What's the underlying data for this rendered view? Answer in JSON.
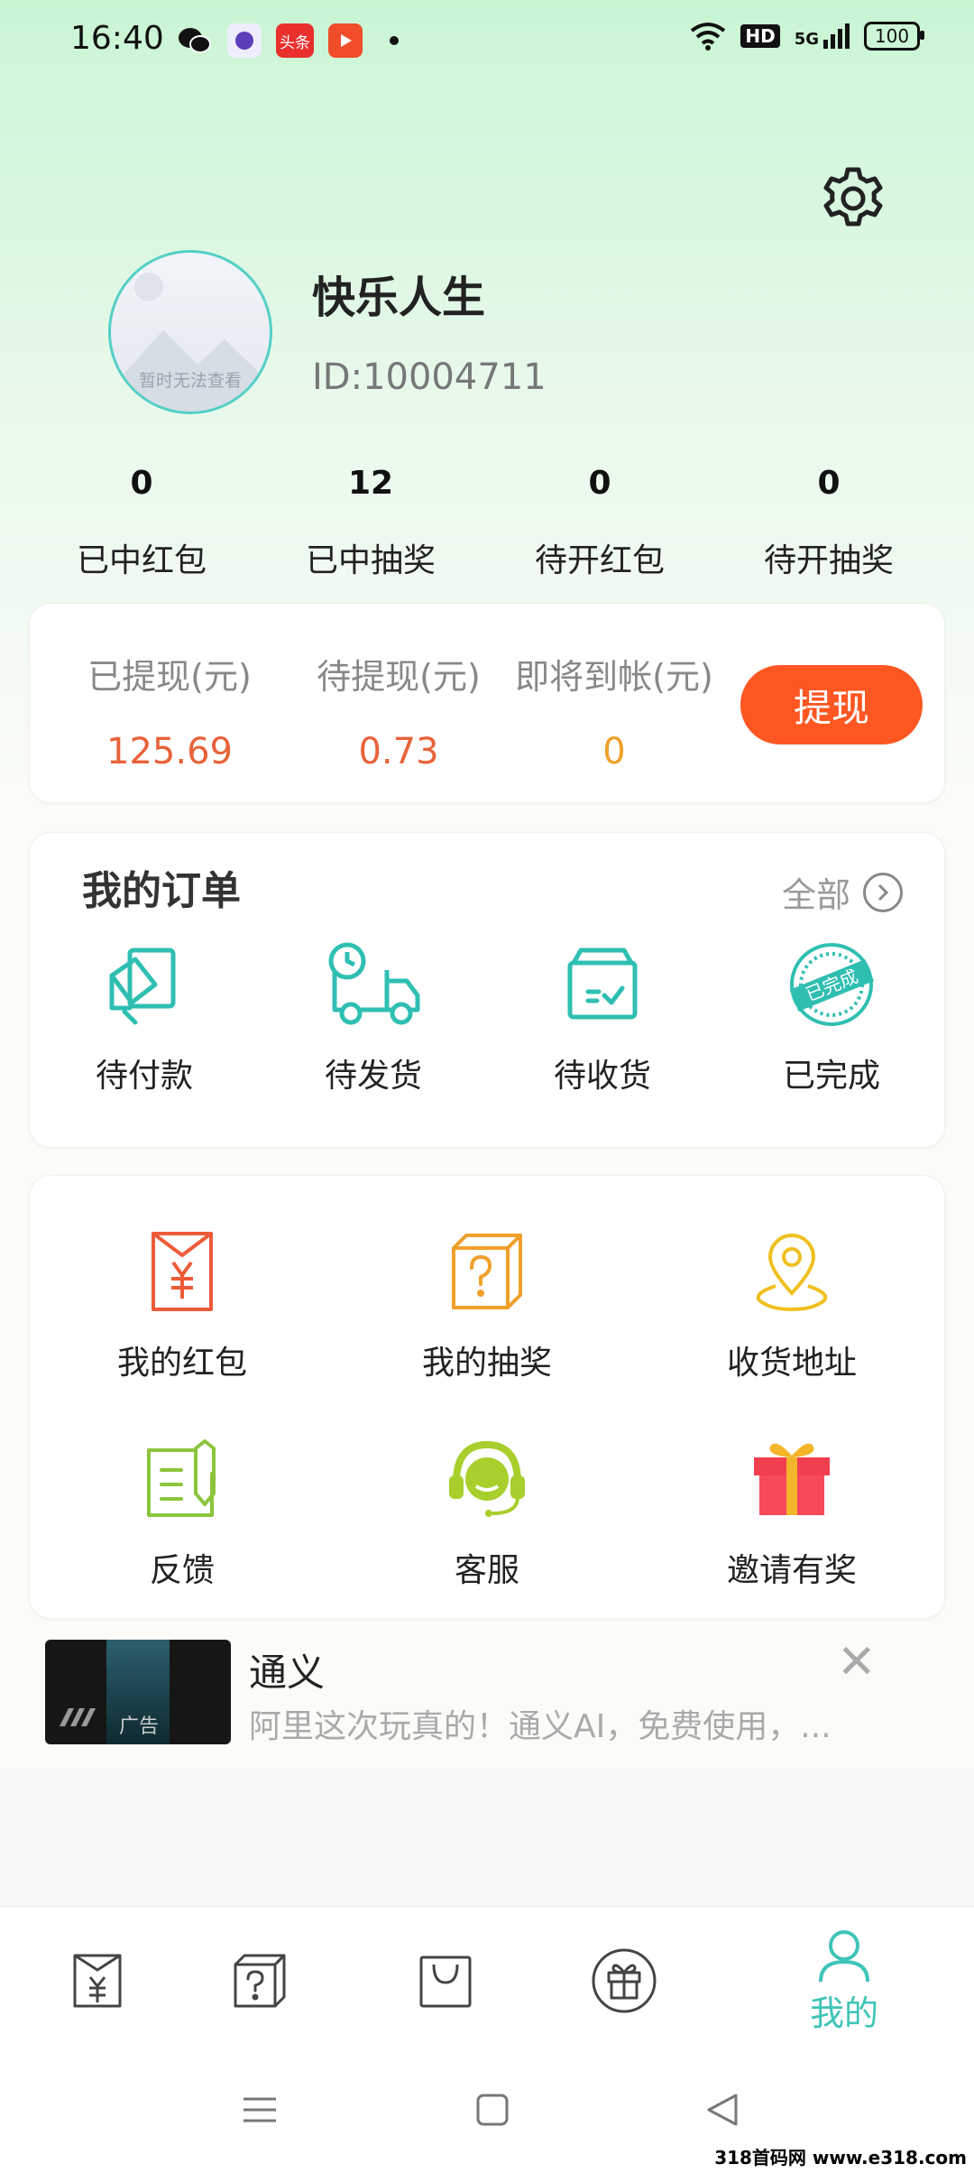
{
  "status_bar": {
    "time": "16:40",
    "app_badge": "头条",
    "hd": "HD",
    "network": "5G",
    "battery": "100"
  },
  "profile": {
    "username": "快乐人生",
    "user_id": "ID:10004711",
    "avatar_text": "暂时无法查看"
  },
  "stats": [
    {
      "value": "0",
      "label": "已中红包"
    },
    {
      "value": "12",
      "label": "已中抽奖"
    },
    {
      "value": "0",
      "label": "待开红包"
    },
    {
      "value": "0",
      "label": "待开抽奖"
    }
  ],
  "withdraw": {
    "items": [
      {
        "label": "已提现(元)",
        "value": "125.69"
      },
      {
        "label": "待提现(元)",
        "value": "0.73"
      },
      {
        "label": "即将到帐(元)",
        "value": "0"
      }
    ],
    "button_label": "提现"
  },
  "orders": {
    "title": "我的订单",
    "all_label": "全部",
    "items": [
      {
        "label": "待付款",
        "icon": "card-payment-icon"
      },
      {
        "label": "待发货",
        "icon": "delivery-truck-icon"
      },
      {
        "label": "待收货",
        "icon": "receive-box-icon"
      },
      {
        "label": "已完成",
        "icon": "completed-stamp-icon",
        "stamp_text": "已完成"
      }
    ]
  },
  "features": [
    {
      "label": "我的红包",
      "icon": "red-envelope-icon"
    },
    {
      "label": "我的抽奖",
      "icon": "mystery-box-icon"
    },
    {
      "label": "收货地址",
      "icon": "location-pin-icon"
    },
    {
      "label": "反馈",
      "icon": "feedback-edit-icon"
    },
    {
      "label": "客服",
      "icon": "customer-service-icon"
    },
    {
      "label": "邀请有奖",
      "icon": "gift-icon"
    }
  ],
  "ad": {
    "title": "通义",
    "description": "阿里这次玩真的！通义AI，免费使用，...",
    "tag": "广告"
  },
  "bottom_nav": {
    "items": [
      {
        "icon": "red-envelope-icon"
      },
      {
        "icon": "mystery-box-icon"
      },
      {
        "icon": "shopping-bag-icon"
      },
      {
        "icon": "gift-icon"
      },
      {
        "icon": "user-icon",
        "label": "我的",
        "active": true
      }
    ]
  },
  "watermark": "318首码网 www.e318.com",
  "colors": {
    "accent": "#3ec4b8",
    "withdraw_button": "#fe5722",
    "amount_red": "#e8623a",
    "amount_orange": "#f0a02a"
  }
}
